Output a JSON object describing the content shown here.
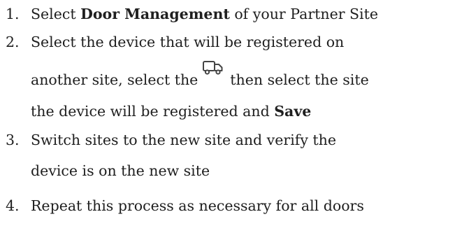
{
  "steps": [
    {
      "number": "1.",
      "lines": [
        {
          "pre": "Select ",
          "bold": "Door Management",
          "post": " of your Partner Site"
        }
      ]
    },
    {
      "number": "2.",
      "lines": [
        {
          "text": "Select the device that will be registered on"
        },
        {
          "pre": "another site, select the",
          "icon": "truck-icon",
          "post": "then select the site"
        },
        {
          "pre": "the device will be registered and ",
          "bold": "Save"
        }
      ]
    },
    {
      "number": "3.",
      "lines": [
        {
          "text": "Switch sites to the new site and verify the"
        },
        {
          "text": "device is on the new site"
        }
      ]
    },
    {
      "number": "4.",
      "lines": [
        {
          "text": "Repeat this process as necessary for all doors"
        }
      ]
    }
  ]
}
